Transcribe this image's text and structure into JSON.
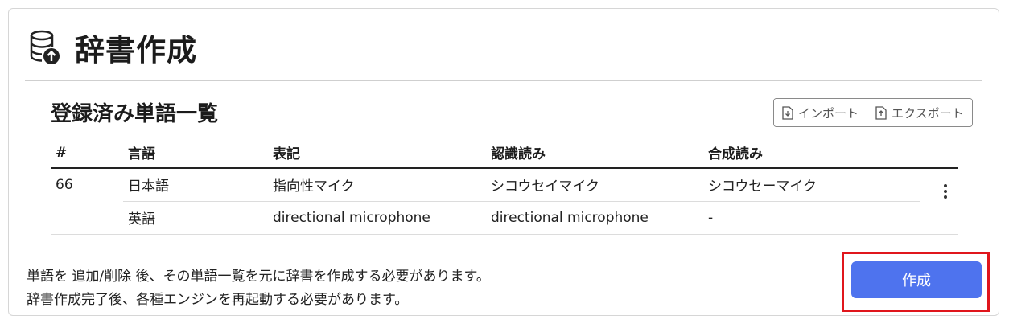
{
  "page": {
    "title": "辞書作成",
    "icon": "database-upload-icon"
  },
  "section": {
    "title": "登録済み単語一覧"
  },
  "toolbar": {
    "import_label": "インポート",
    "export_label": "エクスポート"
  },
  "table": {
    "headers": {
      "num": "#",
      "language": "言語",
      "notation": "表記",
      "recognition": "認識読み",
      "synthesis": "合成読み"
    },
    "entry": {
      "num": "66",
      "rows": [
        {
          "language": "日本語",
          "notation": "指向性マイク",
          "recognition": "シコウセイマイク",
          "synthesis": "シコウセーマイク"
        },
        {
          "language": "英語",
          "notation": "directional microphone",
          "recognition": "directional microphone",
          "synthesis": "-"
        }
      ]
    }
  },
  "notes": {
    "line1": "単語を 追加/削除 後、その単語一覧を元に辞書を作成する必要があります。",
    "line2": "辞書作成完了後、各種エンジンを再起動する必要があります。"
  },
  "actions": {
    "create_label": "作成"
  },
  "colors": {
    "primary": "#4e73ee",
    "highlight": "#e0161c"
  }
}
